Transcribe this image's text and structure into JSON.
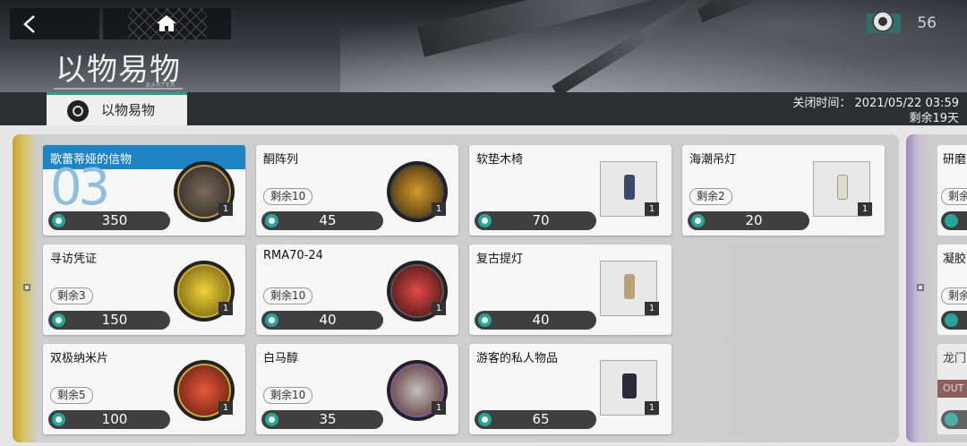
{
  "header": {
    "title": "以物易物",
    "subtitle": "BARTER",
    "currency_value": "56",
    "close_time": "关闭时间： 2021/05/22 03:59",
    "remaining_days": "剩余19天"
  },
  "tab": {
    "label": "以物易物"
  },
  "items": [
    {
      "name": "歌蕾蒂娅的信物",
      "stock": "",
      "price": "350",
      "qty": "1",
      "highlight": true,
      "big_number": "03"
    },
    {
      "name": "寻访凭证",
      "stock": "剩余3",
      "price": "150",
      "qty": "1"
    },
    {
      "name": "双极纳米片",
      "stock": "剩余5",
      "price": "100",
      "qty": "1"
    },
    {
      "name": "酮阵列",
      "stock": "剩余10",
      "price": "45",
      "qty": "1"
    },
    {
      "name": "RMA70-24",
      "stock": "剩余10",
      "price": "40",
      "qty": "1"
    },
    {
      "name": "白马醇",
      "stock": "剩余10",
      "price": "35",
      "qty": "1"
    },
    {
      "name": "软垫木椅",
      "stock": "",
      "price": "70",
      "qty": "1"
    },
    {
      "name": "复古提灯",
      "stock": "",
      "price": "40",
      "qty": "1"
    },
    {
      "name": "游客的私人物品",
      "stock": "",
      "price": "65",
      "qty": "1"
    },
    {
      "name": "海潮吊灯",
      "stock": "剩余2",
      "price": "20",
      "qty": "1"
    }
  ],
  "right_items": [
    {
      "name": "研磨",
      "stock": "剩余"
    },
    {
      "name": "凝胶",
      "stock": "剩余"
    },
    {
      "name": "龙门",
      "tag": "OUT"
    }
  ],
  "colors": {
    "accent": "#26a59a",
    "highlight": "#1f84c3",
    "gold": "#c7a533"
  }
}
